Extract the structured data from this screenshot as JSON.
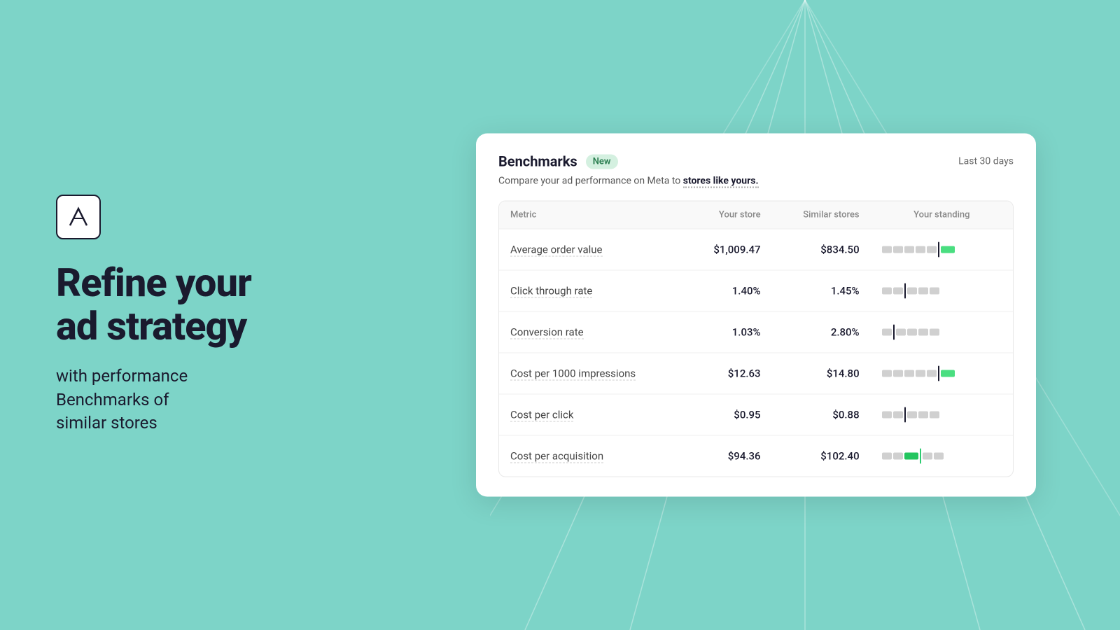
{
  "background": {
    "color": "#7dd4c8"
  },
  "left": {
    "headline_line1": "Refine your",
    "headline_line2": "ad strategy",
    "subheadline": "with performance\nBenchmarks of\nsimilar stores"
  },
  "card": {
    "title": "Benchmarks",
    "badge": "New",
    "subtitle_text": "Compare your ad performance on Meta to ",
    "subtitle_bold": "stores like yours.",
    "last_days": "Last 30 days",
    "table": {
      "headers": [
        "Metric",
        "Your store",
        "Similar stores",
        "Your standing"
      ],
      "rows": [
        {
          "metric": "Average order value",
          "your_store": "$1,009.47",
          "similar_stores": "$834.50",
          "standing": "high_right"
        },
        {
          "metric": "Click through rate",
          "your_store": "1.40%",
          "similar_stores": "1.45%",
          "standing": "mid_center"
        },
        {
          "metric": "Conversion rate",
          "your_store": "1.03%",
          "similar_stores": "2.80%",
          "standing": "low_left"
        },
        {
          "metric": "Cost per 1000 impressions",
          "your_store": "$12.63",
          "similar_stores": "$14.80",
          "standing": "high_right"
        },
        {
          "metric": "Cost per click",
          "your_store": "$0.95",
          "similar_stores": "$0.88",
          "standing": "mid_center"
        },
        {
          "metric": "Cost per acquisition",
          "your_store": "$94.36",
          "similar_stores": "$102.40",
          "standing": "mid_center_green"
        }
      ]
    }
  }
}
